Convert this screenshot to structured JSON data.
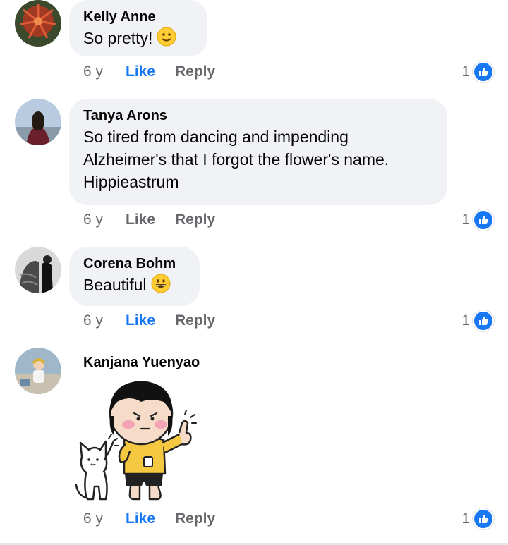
{
  "colors": {
    "like_active": "#1877f2",
    "meta_gray": "#65676b",
    "bubble_bg": "#f0f2f5"
  },
  "comments": [
    {
      "author": "Kelly Anne",
      "text": "So pretty!",
      "emoji": "slightly-smiling-face-emoji",
      "time": "6 y",
      "like_label": "Like",
      "like_active": true,
      "reply_label": "Reply",
      "reaction_count": "1",
      "reaction_icon": "thumbs-up-icon"
    },
    {
      "author": "Tanya Arons",
      "text_lines": [
        "So tired from dancing and impending",
        "Alzheimer's that I forgot the flower's name.",
        "Hippieastrum"
      ],
      "time": "6 y",
      "like_label": "Like",
      "like_active": false,
      "reply_label": "Reply",
      "reaction_count": "1",
      "reaction_icon": "thumbs-up-icon"
    },
    {
      "author": "Corena Bohm",
      "text": "Beautiful",
      "emoji": "grinning-face-emoji",
      "time": "6 y",
      "like_label": "Like",
      "like_active": true,
      "reply_label": "Reply",
      "reaction_count": "1",
      "reaction_icon": "thumbs-up-icon"
    },
    {
      "author": "Kanjana Yuenyao",
      "sticker": "thumbs-up-girl-cat-sticker",
      "time": "6 y",
      "like_label": "Like",
      "like_active": true,
      "reply_label": "Reply",
      "reaction_count": "1",
      "reaction_icon": "thumbs-up-icon"
    }
  ]
}
